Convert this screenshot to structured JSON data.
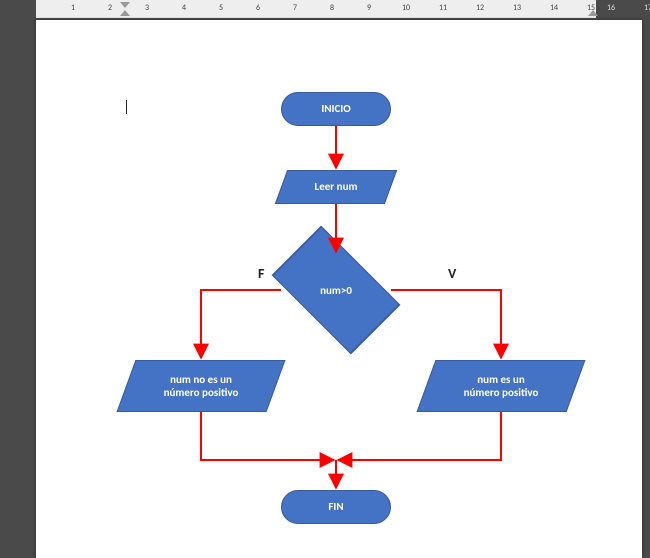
{
  "ruler": {
    "left_numbers": [
      "3",
      "2",
      "1"
    ],
    "active_numbers": [
      "1",
      "2",
      "3",
      "4",
      "5",
      "6",
      "7",
      "8",
      "9",
      "10",
      "11",
      "12",
      "13",
      "14",
      "15"
    ],
    "right_numbers": [
      "16",
      "17"
    ]
  },
  "flowchart": {
    "start": "INICIO",
    "read": "Leer num",
    "decision": "num>0",
    "branch_false": "F",
    "branch_true": "V",
    "out_false_l1": "num no es un",
    "out_false_l2": "número positivo",
    "out_true_l1": "num es un",
    "out_true_l2": "número positivo",
    "end": "FIN"
  },
  "colors": {
    "shape_fill": "#4472c4",
    "shape_border": "#375b9e",
    "arrow": "#ff0000"
  }
}
